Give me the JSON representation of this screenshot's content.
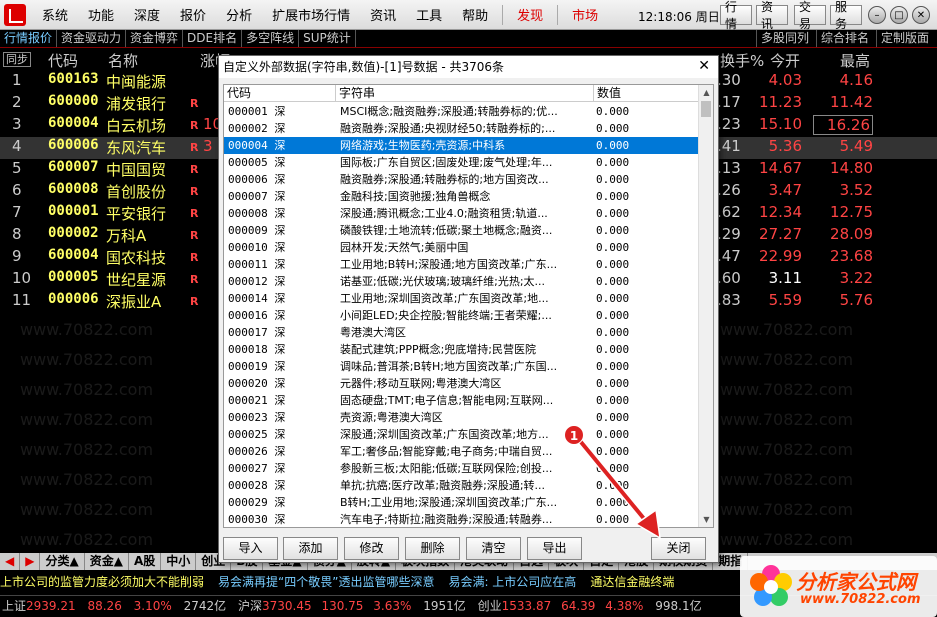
{
  "menubar": {
    "items": [
      "系统",
      "功能",
      "深度",
      "报价",
      "分析",
      "扩展市场行情",
      "资讯",
      "工具",
      "帮助"
    ],
    "highlight_items": [
      "发现",
      "市场"
    ],
    "clock": "12:18:06 周日",
    "right_buttons": [
      "行情",
      "资讯",
      "交易",
      "服务"
    ]
  },
  "tabbar": {
    "left_tabs": [
      "行情报价",
      "资金驱动力",
      "资金博弈",
      "DDE排名",
      "多空阵线",
      "SUP统计"
    ],
    "right_tabs": [
      "多股同列",
      "综合排名",
      "定制版面"
    ]
  },
  "table_header": {
    "sync": "同步",
    "code": "代码",
    "name": "名称",
    "change": "涨幅",
    "tail": "换手%",
    "open": "今开",
    "high": "最高"
  },
  "stock_rows": [
    {
      "num": "1",
      "code": "600163",
      "name": "中闽能源",
      "flag": "",
      "change": "",
      "vol": ".30",
      "open": "4.03",
      "high": "4.16",
      "open_color": "#f44",
      "high_color": "#f44"
    },
    {
      "num": "2",
      "code": "600000",
      "name": "浦发银行",
      "flag": "R",
      "change": "",
      "vol": ".17",
      "open": "11.23",
      "high": "11.42",
      "open_color": "#f44",
      "high_color": "#f44"
    },
    {
      "num": "3",
      "code": "600004",
      "name": "白云机场",
      "flag": "R",
      "change": "10",
      "vol": ".23",
      "open": "15.10",
      "high": "16.26",
      "open_color": "#f44",
      "high_color": "#f44"
    },
    {
      "num": "4",
      "code": "600006",
      "name": "东风汽车",
      "flag": "R",
      "change": "3",
      "vol": ".41",
      "open": "5.36",
      "high": "5.49",
      "open_color": "#f44",
      "high_color": "#f44"
    },
    {
      "num": "5",
      "code": "600007",
      "name": "中国国贸",
      "flag": "R",
      "change": "",
      "vol": ".13",
      "open": "14.67",
      "high": "14.80",
      "open_color": "#f44",
      "high_color": "#f44"
    },
    {
      "num": "6",
      "code": "600008",
      "name": "首创股份",
      "flag": "R",
      "change": "",
      "vol": ".26",
      "open": "3.47",
      "high": "3.52",
      "open_color": "#f44",
      "high_color": "#f44"
    },
    {
      "num": "7",
      "code": "000001",
      "name": "平安银行",
      "flag": "R",
      "change": "",
      "vol": ".62",
      "open": "12.34",
      "high": "12.75",
      "open_color": "#f44",
      "high_color": "#f44"
    },
    {
      "num": "8",
      "code": "000002",
      "name": "万科A",
      "flag": "R",
      "change": "",
      "vol": ".29",
      "open": "27.27",
      "high": "28.09",
      "open_color": "#f44",
      "high_color": "#f44"
    },
    {
      "num": "9",
      "code": "600004",
      "name": "国农科技",
      "flag": "R",
      "change": "",
      "vol": ".47",
      "open": "22.99",
      "high": "23.68",
      "open_color": "#f44",
      "high_color": "#f44"
    },
    {
      "num": "10",
      "code": "000005",
      "name": "世纪星源",
      "flag": "R",
      "change": "",
      "vol": ".60",
      "open": "3.11",
      "high": "3.22",
      "open_color": "#fff",
      "high_color": "#f44"
    },
    {
      "num": "11",
      "code": "000006",
      "name": "深振业A",
      "flag": "R",
      "change": "",
      "vol": ".83",
      "open": "5.59",
      "high": "5.76",
      "open_color": "#f44",
      "high_color": "#f44"
    }
  ],
  "watermark": "www.70822.com",
  "dialog": {
    "title": "自定义外部数据(字符串,数值)-[1]号数据 - 共3706条",
    "close_glyph": "✕",
    "headers": [
      "代码",
      "字符串",
      "数值"
    ],
    "rows": [
      {
        "code": "000001 深",
        "str": "MSCI概念;融资融券;深股通;转融券标的;优...",
        "val": "0.000"
      },
      {
        "code": "000002 深",
        "str": "融资融券;深股通;央视财经50;转融券标的;...",
        "val": "0.000"
      },
      {
        "code": "000004 深",
        "str": "网络游戏;生物医药;壳资源;中科系",
        "val": "0.000"
      },
      {
        "code": "000005 深",
        "str": "国际板;广东自贸区;固废处理;废气处理;年...",
        "val": "0.000"
      },
      {
        "code": "000006 深",
        "str": "融资融券;深股通;转融券标的;地方国资改...",
        "val": "0.000"
      },
      {
        "code": "000007 深",
        "str": "金融科技;国资驰援;独角兽概念",
        "val": "0.000"
      },
      {
        "code": "000008 深",
        "str": "深股通;腾讯概念;工业4.0;融资租赁;轨道...",
        "val": "0.000"
      },
      {
        "code": "000009 深",
        "str": "磷酸铁锂;土地流转;低碳;聚土地概念;融资...",
        "val": "0.000"
      },
      {
        "code": "000010 深",
        "str": "园林开发;天然气;美丽中国",
        "val": "0.000"
      },
      {
        "code": "000011 深",
        "str": "工业用地;B转H;深股通;地方国资改革;广东...",
        "val": "0.000"
      },
      {
        "code": "000012 深",
        "str": "诺基亚;低碳;光伏玻璃;玻璃纤维;光热;太...",
        "val": "0.000"
      },
      {
        "code": "000014 深",
        "str": "工业用地;深圳国资改革;广东国资改革;地...",
        "val": "0.000"
      },
      {
        "code": "000016 深",
        "str": "小间距LED;央企控股;智能终端;王者荣耀;...",
        "val": "0.000"
      },
      {
        "code": "000017 深",
        "str": "粤港澳大湾区",
        "val": "0.000"
      },
      {
        "code": "000018 深",
        "str": "装配式建筑;PPP概念;兜底增持;民营医院",
        "val": "0.000"
      },
      {
        "code": "000019 深",
        "str": "调味品;普洱茶;B转H;地方国资改革;广东国...",
        "val": "0.000"
      },
      {
        "code": "000020 深",
        "str": "元器件;移动互联网;粤港澳大湾区",
        "val": "0.000"
      },
      {
        "code": "000021 深",
        "str": "固态硬盘;TMT;电子信息;智能电网;互联网...",
        "val": "0.000"
      },
      {
        "code": "000023 深",
        "str": "壳资源;粤港澳大湾区",
        "val": "0.000"
      },
      {
        "code": "000025 深",
        "str": "深股通;深圳国资改革;广东国资改革;地方...",
        "val": "0.000"
      },
      {
        "code": "000026 深",
        "str": "军工;奢侈品;智能穿戴;电子商务;中瑞自贸...",
        "val": "0.000"
      },
      {
        "code": "000027 深",
        "str": "参股新三板;太阳能;低碳;互联网保险;创投...",
        "val": "0.000"
      },
      {
        "code": "000028 深",
        "str": "单抗;抗癌;医疗改革;融资融券;深股通;转...",
        "val": "0.000"
      },
      {
        "code": "000029 深",
        "str": "B转H;工业用地;深股通;深圳国资改革;广东...",
        "val": "0.000"
      },
      {
        "code": "000030 深",
        "str": "汽车电子;特斯拉;融资融券;深股通;转融券...",
        "val": "0.000"
      }
    ],
    "selected_index": 2,
    "buttons": [
      "导入",
      "添加",
      "修改",
      "删除",
      "清空",
      "导出",
      "关闭"
    ]
  },
  "callout_number": "1",
  "sheetbar": {
    "tabs": [
      "分类▲",
      "资金▲",
      "A股",
      "中小",
      "创业",
      "B股",
      "基金▲",
      "债券▲",
      "股转▲",
      "板块指数",
      "港美联动",
      "自选",
      "板块",
      "自定",
      "港股",
      "期权期货",
      "期指"
    ]
  },
  "ticker": [
    {
      "text": "上市公司的监管力度必须加大不能削弱",
      "color": "#ff6"
    },
    {
      "text": "易会满再提“四个敬畏”透出监管哪些深意",
      "color": "#7cf"
    },
    {
      "text": "易会满: 上市公司应在高",
      "color": "#7cf"
    },
    {
      "text": "通达信金融终端",
      "color": "#ff6"
    }
  ],
  "statusbar": {
    "sh_label": "上证",
    "sh_val": "2939.21",
    "sh_chg": "88.26",
    "sh_pct": "3.10%",
    "sh_amt": "2742亿",
    "hs_label": "沪深",
    "hs_val": "3730.45",
    "hs_chg": "130.75",
    "hs_pct": "3.63%",
    "hs_amt": "1951亿",
    "cy_label": "创业",
    "cy_val": "1533.87",
    "cy_chg": "64.39",
    "cy_pct": "4.38%",
    "cy_amt": "998.1亿"
  },
  "brand": {
    "name": "分析家公式网",
    "url": "www.70822.com"
  }
}
